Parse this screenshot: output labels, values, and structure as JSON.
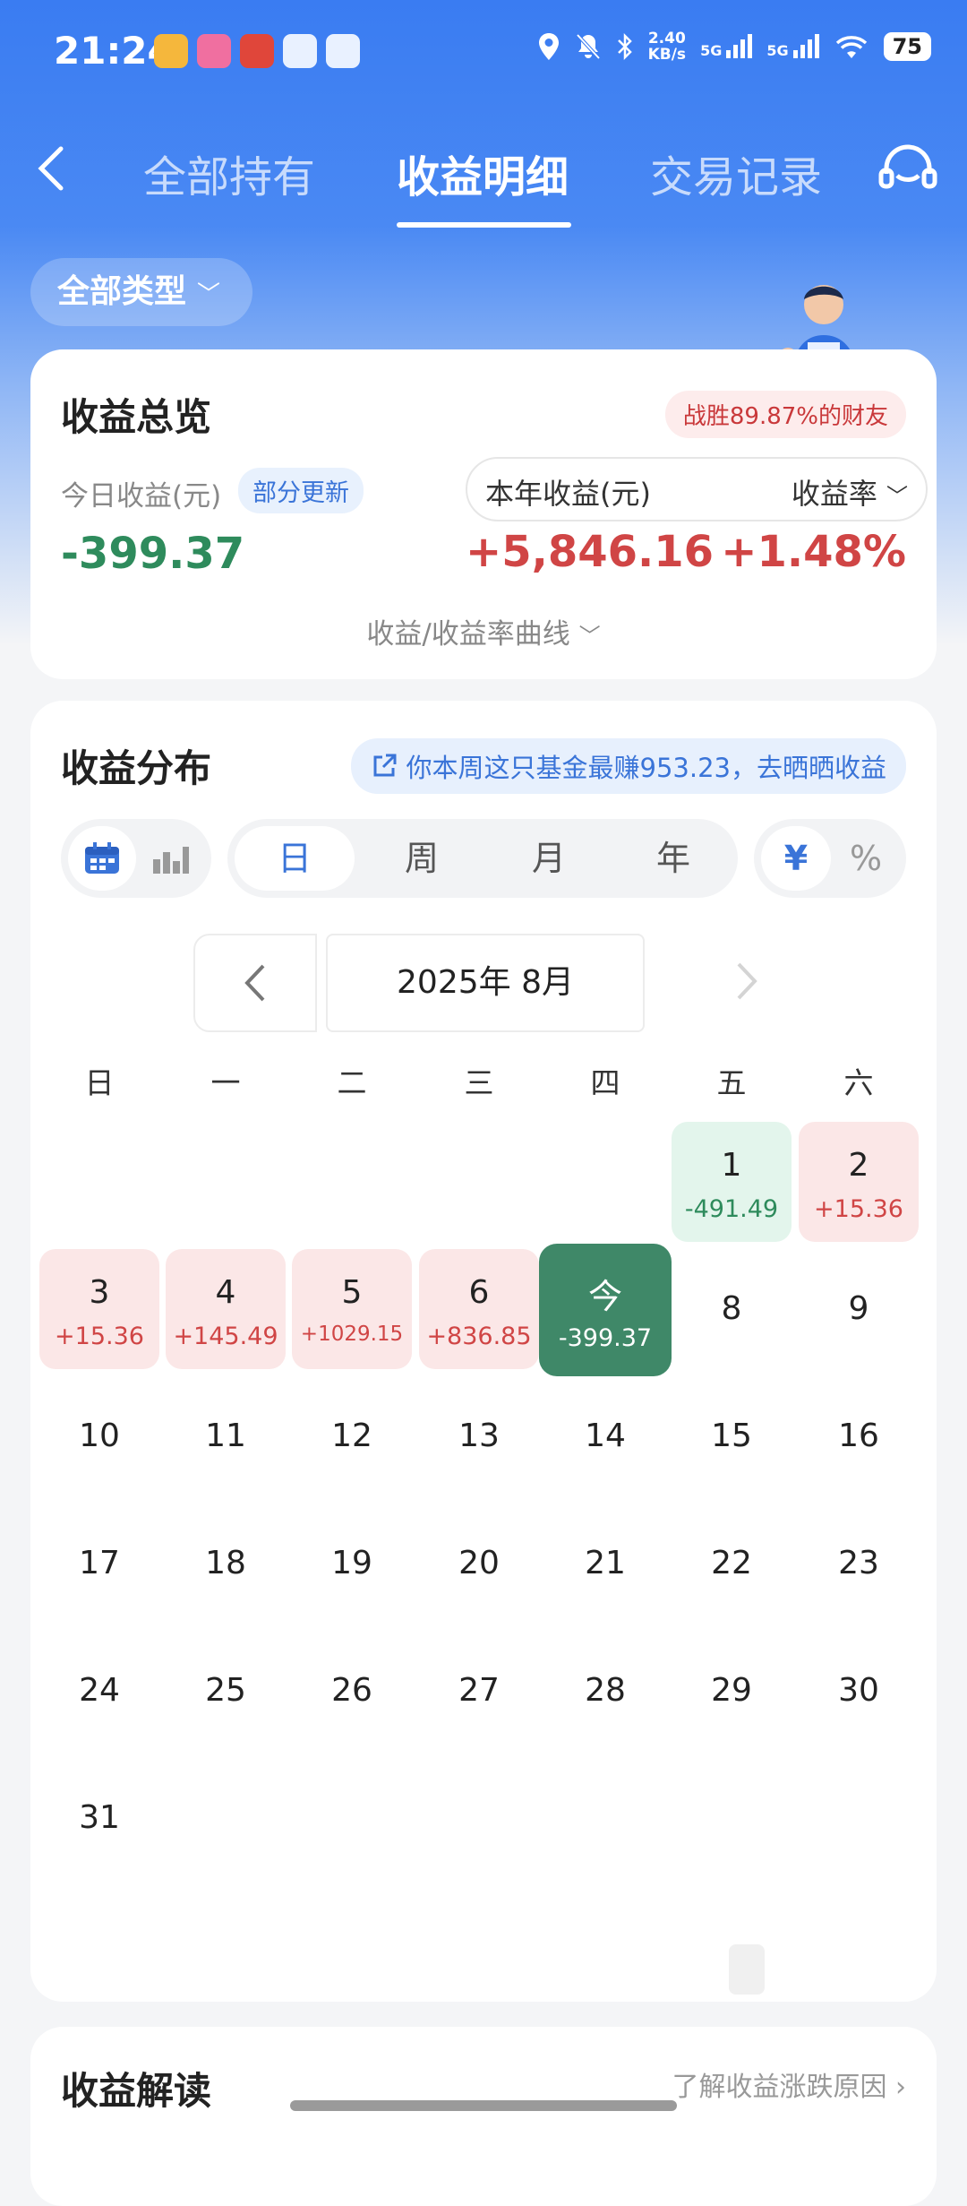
{
  "status_bar": {
    "time": "21:24",
    "net_speed_top": "2.40",
    "net_speed_bottom": "KB/s",
    "signal1": "5G",
    "signal2": "5G",
    "battery": "75"
  },
  "header": {
    "tabs": [
      "全部持有",
      "收益明细",
      "交易记录"
    ],
    "active_tab": 1
  },
  "filter": {
    "type_label": "全部类型"
  },
  "overview": {
    "title": "收益总览",
    "beat_badge": "战胜89.87%的财友",
    "today_label": "今日收益(元)",
    "partial_badge": "部分更新",
    "today_value": "-399.37",
    "year_label": "本年收益(元)",
    "rate_label": "收益率",
    "year_value": "+5,846.16",
    "rate_value": "+1.48%",
    "curve_link": "收益/收益率曲线"
  },
  "distribution": {
    "title": "收益分布",
    "promo": "你本周这只基金最赚953.23，去晒晒收益",
    "periods": [
      "日",
      "周",
      "月",
      "年"
    ],
    "currency_symbol": "¥",
    "percent_symbol": "%",
    "month_label": "2025年 8月",
    "weekdays": [
      "日",
      "一",
      "二",
      "三",
      "四",
      "五",
      "六"
    ],
    "days": [
      {
        "n": "1",
        "v": "-491.49",
        "kind": "neg"
      },
      {
        "n": "2",
        "v": "+15.36",
        "kind": "pos"
      },
      {
        "n": "3",
        "v": "+15.36",
        "kind": "pos"
      },
      {
        "n": "4",
        "v": "+145.49",
        "kind": "pos"
      },
      {
        "n": "5",
        "v": "+1029.15",
        "kind": "pos"
      },
      {
        "n": "6",
        "v": "+836.85",
        "kind": "pos"
      },
      {
        "n": "今",
        "v": "-399.37",
        "kind": "today"
      },
      {
        "n": "8"
      },
      {
        "n": "9"
      },
      {
        "n": "10"
      },
      {
        "n": "11"
      },
      {
        "n": "12"
      },
      {
        "n": "13"
      },
      {
        "n": "14"
      },
      {
        "n": "15"
      },
      {
        "n": "16"
      },
      {
        "n": "17"
      },
      {
        "n": "18"
      },
      {
        "n": "19"
      },
      {
        "n": "20"
      },
      {
        "n": "21"
      },
      {
        "n": "22"
      },
      {
        "n": "23"
      },
      {
        "n": "24"
      },
      {
        "n": "25"
      },
      {
        "n": "26"
      },
      {
        "n": "27"
      },
      {
        "n": "28"
      },
      {
        "n": "29"
      },
      {
        "n": "30"
      },
      {
        "n": "31"
      }
    ]
  },
  "interpretation": {
    "title": "收益解读",
    "link": "了解收益涨跌原因"
  },
  "colors": {
    "brand_blue": "#3a7cf2",
    "gain_red": "#d04545",
    "loss_green": "#2e8b5c",
    "today_green": "#3f8868"
  }
}
